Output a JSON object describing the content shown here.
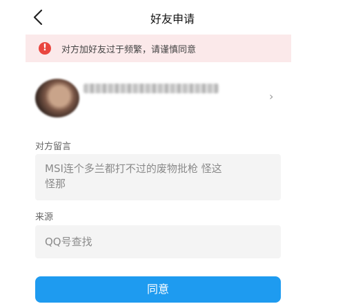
{
  "header": {
    "title": "好友申请",
    "back_icon": "chevron-left-icon"
  },
  "warning": {
    "icon": "exclamation-circle-icon",
    "text": "对方加好友过于频繁，请谨慎同意",
    "icon_color": "#e9463f",
    "background": "#fbe9ea"
  },
  "requester": {
    "avatar_icon": "avatar",
    "nickname_blurred": true,
    "chevron_icon": "chevron-right-icon"
  },
  "message": {
    "label": "对方留言",
    "line1": "MSI连个多兰都打不过的废物批枪 怪这",
    "line2": "怪那"
  },
  "source": {
    "label": "来源",
    "value": "QQ号查找"
  },
  "agree_button": {
    "label": "同意",
    "color": "#1e9bf0"
  }
}
